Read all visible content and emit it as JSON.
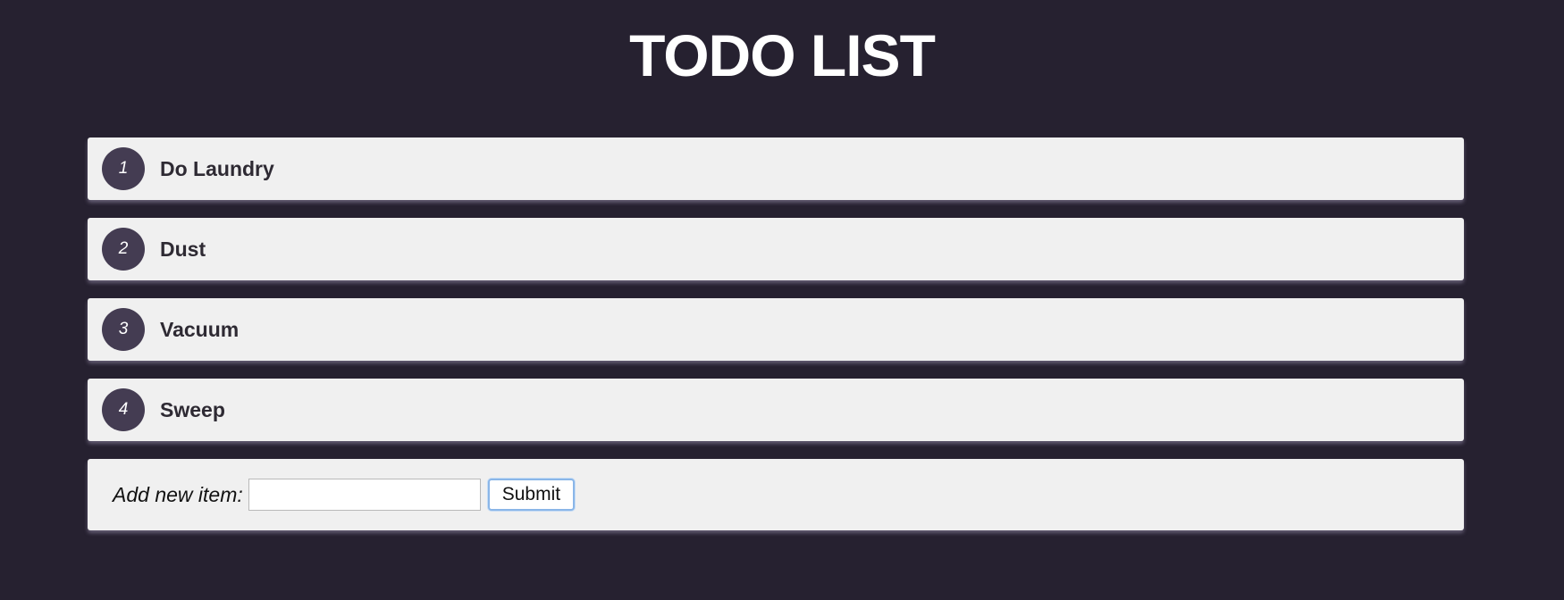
{
  "header": {
    "title": "TODO LIST"
  },
  "todos": [
    {
      "number": "1",
      "label": "Do Laundry"
    },
    {
      "number": "2",
      "label": "Dust"
    },
    {
      "number": "3",
      "label": "Vacuum"
    },
    {
      "number": "4",
      "label": "Sweep"
    }
  ],
  "add_form": {
    "label": "Add new item:",
    "input_value": "",
    "input_placeholder": "",
    "submit_label": "Submit"
  },
  "colors": {
    "background": "#262130",
    "card": "#f0f0f0",
    "badge": "#443c52",
    "focus_ring": "#8ab6e8"
  }
}
